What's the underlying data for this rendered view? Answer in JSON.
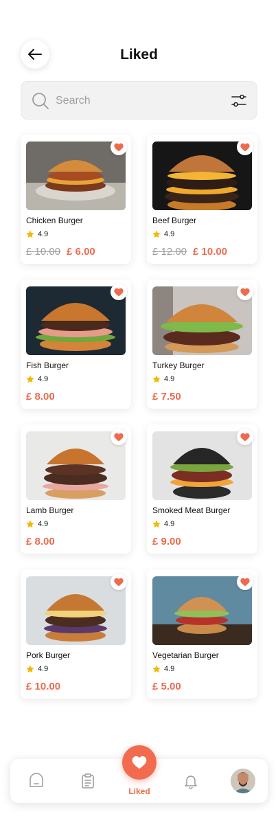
{
  "header": {
    "title": "Liked"
  },
  "search": {
    "placeholder": "Search",
    "value": ""
  },
  "colors": {
    "accent": "#ef6a4d",
    "star": "#f5b800",
    "background": "#ffffff"
  },
  "items": [
    {
      "name": "Chicken Burger",
      "rating": "4.9",
      "old_price": "£ 10.00",
      "price": "£ 6.00",
      "liked": true
    },
    {
      "name": "Beef Burger",
      "rating": "4.9",
      "old_price": "£ 12.00",
      "price": "£ 10.00",
      "liked": true
    },
    {
      "name": "Fish Burger",
      "rating": "4.9",
      "old_price": "",
      "price": "£ 8.00",
      "liked": true
    },
    {
      "name": "Turkey Burger",
      "rating": "4.9",
      "old_price": "",
      "price": "£ 7.50",
      "liked": true
    },
    {
      "name": "Lamb Burger",
      "rating": "4.9",
      "old_price": "",
      "price": "£ 8.00",
      "liked": true
    },
    {
      "name": "Smoked Meat Burger",
      "rating": "4.9",
      "old_price": "",
      "price": "£ 9.00",
      "liked": true
    },
    {
      "name": "Pork Burger",
      "rating": "4.9",
      "old_price": "",
      "price": "£ 10.00",
      "liked": true
    },
    {
      "name": "Vegetarian Burger",
      "rating": "4.9",
      "old_price": "",
      "price": "£ 5.00",
      "liked": true
    }
  ],
  "nav": {
    "items": [
      {
        "icon": "home-icon"
      },
      {
        "icon": "orders-clipboard-icon"
      },
      {
        "icon": "heart-icon",
        "label": "Liked",
        "active": true
      },
      {
        "icon": "bell-icon"
      },
      {
        "icon": "profile-avatar"
      }
    ],
    "active_label": "Liked"
  }
}
